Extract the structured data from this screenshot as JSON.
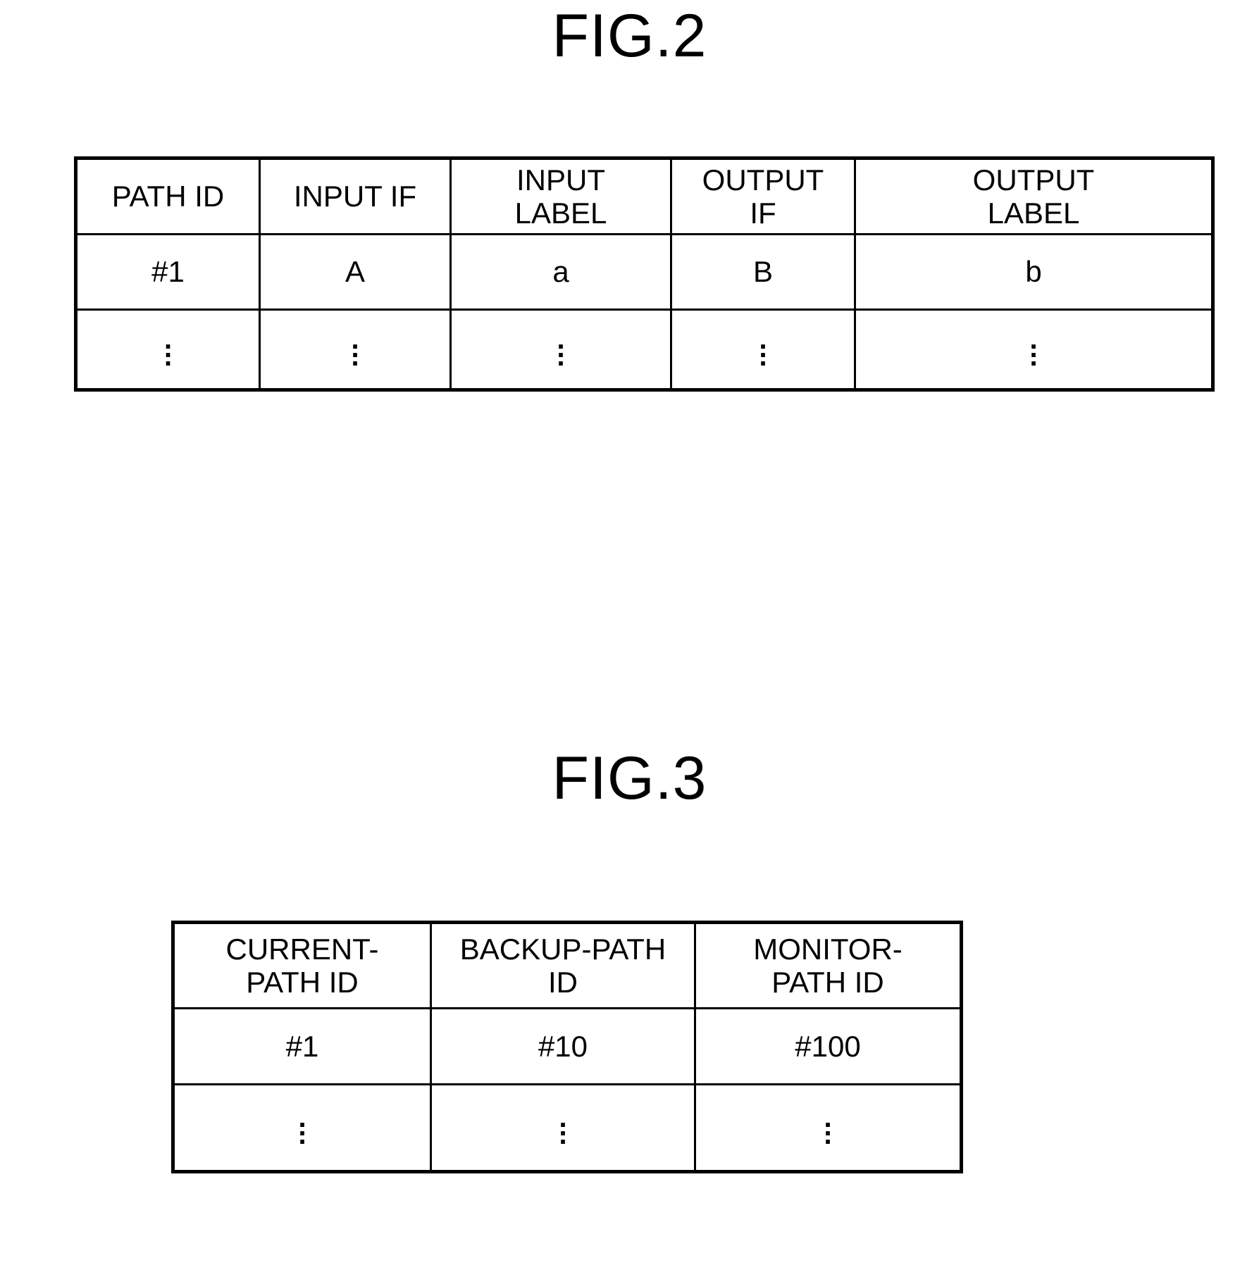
{
  "figures": [
    {
      "title": "FIG.2",
      "table": {
        "headers": [
          "PATH ID",
          "INPUT IF",
          "INPUT\nLABEL",
          "OUTPUT\nIF",
          "OUTPUT\nLABEL"
        ],
        "rows": [
          [
            "#1",
            "A",
            "a",
            "B",
            "b"
          ],
          [
            "⋮",
            "⋮",
            "⋮",
            "⋮",
            "⋮"
          ]
        ]
      }
    },
    {
      "title": "FIG.3",
      "table": {
        "headers": [
          "CURRENT-\nPATH ID",
          "BACKUP-PATH\nID",
          "MONITOR-\nPATH ID"
        ],
        "rows": [
          [
            "#1",
            "#10",
            "#100"
          ],
          [
            "⋮",
            "⋮",
            "⋮"
          ]
        ]
      }
    }
  ],
  "ellipsis": ".\n.\n.",
  "colors": {
    "ink": "#000000",
    "paper": "#ffffff"
  }
}
